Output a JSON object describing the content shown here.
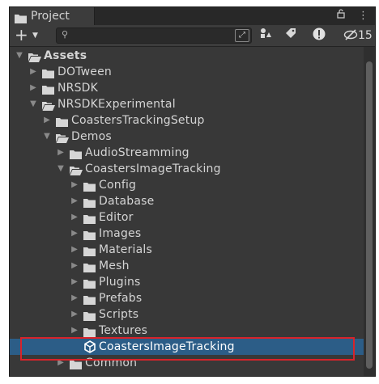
{
  "tab": {
    "title": "Project"
  },
  "tab_controls": {
    "lock": "🔒",
    "menu": "⋮"
  },
  "toolbar": {
    "create_label": "+",
    "search_placeholder": "",
    "hidden_count": "15"
  },
  "tree": {
    "rows": [
      {
        "label": "Assets",
        "depth": 0,
        "expanded": true,
        "kind": "folder"
      },
      {
        "label": "DOTween",
        "depth": 1,
        "expanded": false,
        "kind": "folder"
      },
      {
        "label": "NRSDK",
        "depth": 1,
        "expanded": false,
        "kind": "folder"
      },
      {
        "label": "NRSDKExperimental",
        "depth": 1,
        "expanded": true,
        "kind": "folder"
      },
      {
        "label": "CoastersTrackingSetup",
        "depth": 2,
        "expanded": false,
        "kind": "folder"
      },
      {
        "label": "Demos",
        "depth": 2,
        "expanded": true,
        "kind": "folder"
      },
      {
        "label": "AudioStreamming",
        "depth": 3,
        "expanded": false,
        "kind": "folder"
      },
      {
        "label": "CoastersImageTracking",
        "depth": 3,
        "expanded": true,
        "kind": "folder"
      },
      {
        "label": "Config",
        "depth": 4,
        "expanded": false,
        "kind": "folder"
      },
      {
        "label": "Database",
        "depth": 4,
        "expanded": false,
        "kind": "folder"
      },
      {
        "label": "Editor",
        "depth": 4,
        "expanded": false,
        "kind": "folder"
      },
      {
        "label": "Images",
        "depth": 4,
        "expanded": false,
        "kind": "folder"
      },
      {
        "label": "Materials",
        "depth": 4,
        "expanded": false,
        "kind": "folder"
      },
      {
        "label": "Mesh",
        "depth": 4,
        "expanded": false,
        "kind": "folder"
      },
      {
        "label": "Plugins",
        "depth": 4,
        "expanded": false,
        "kind": "folder"
      },
      {
        "label": "Prefabs",
        "depth": 4,
        "expanded": false,
        "kind": "folder"
      },
      {
        "label": "Scripts",
        "depth": 4,
        "expanded": false,
        "kind": "folder"
      },
      {
        "label": "Textures",
        "depth": 4,
        "expanded": false,
        "kind": "folder"
      },
      {
        "label": "CoastersImageTracking",
        "depth": 4,
        "expanded": false,
        "kind": "scene",
        "selected": true
      },
      {
        "label": "Common",
        "depth": 3,
        "expanded": false,
        "kind": "folder"
      }
    ]
  },
  "colors": {
    "panel_bg": "#383838",
    "selection": "#2c5d87",
    "highlight_box": "#d8232a"
  }
}
